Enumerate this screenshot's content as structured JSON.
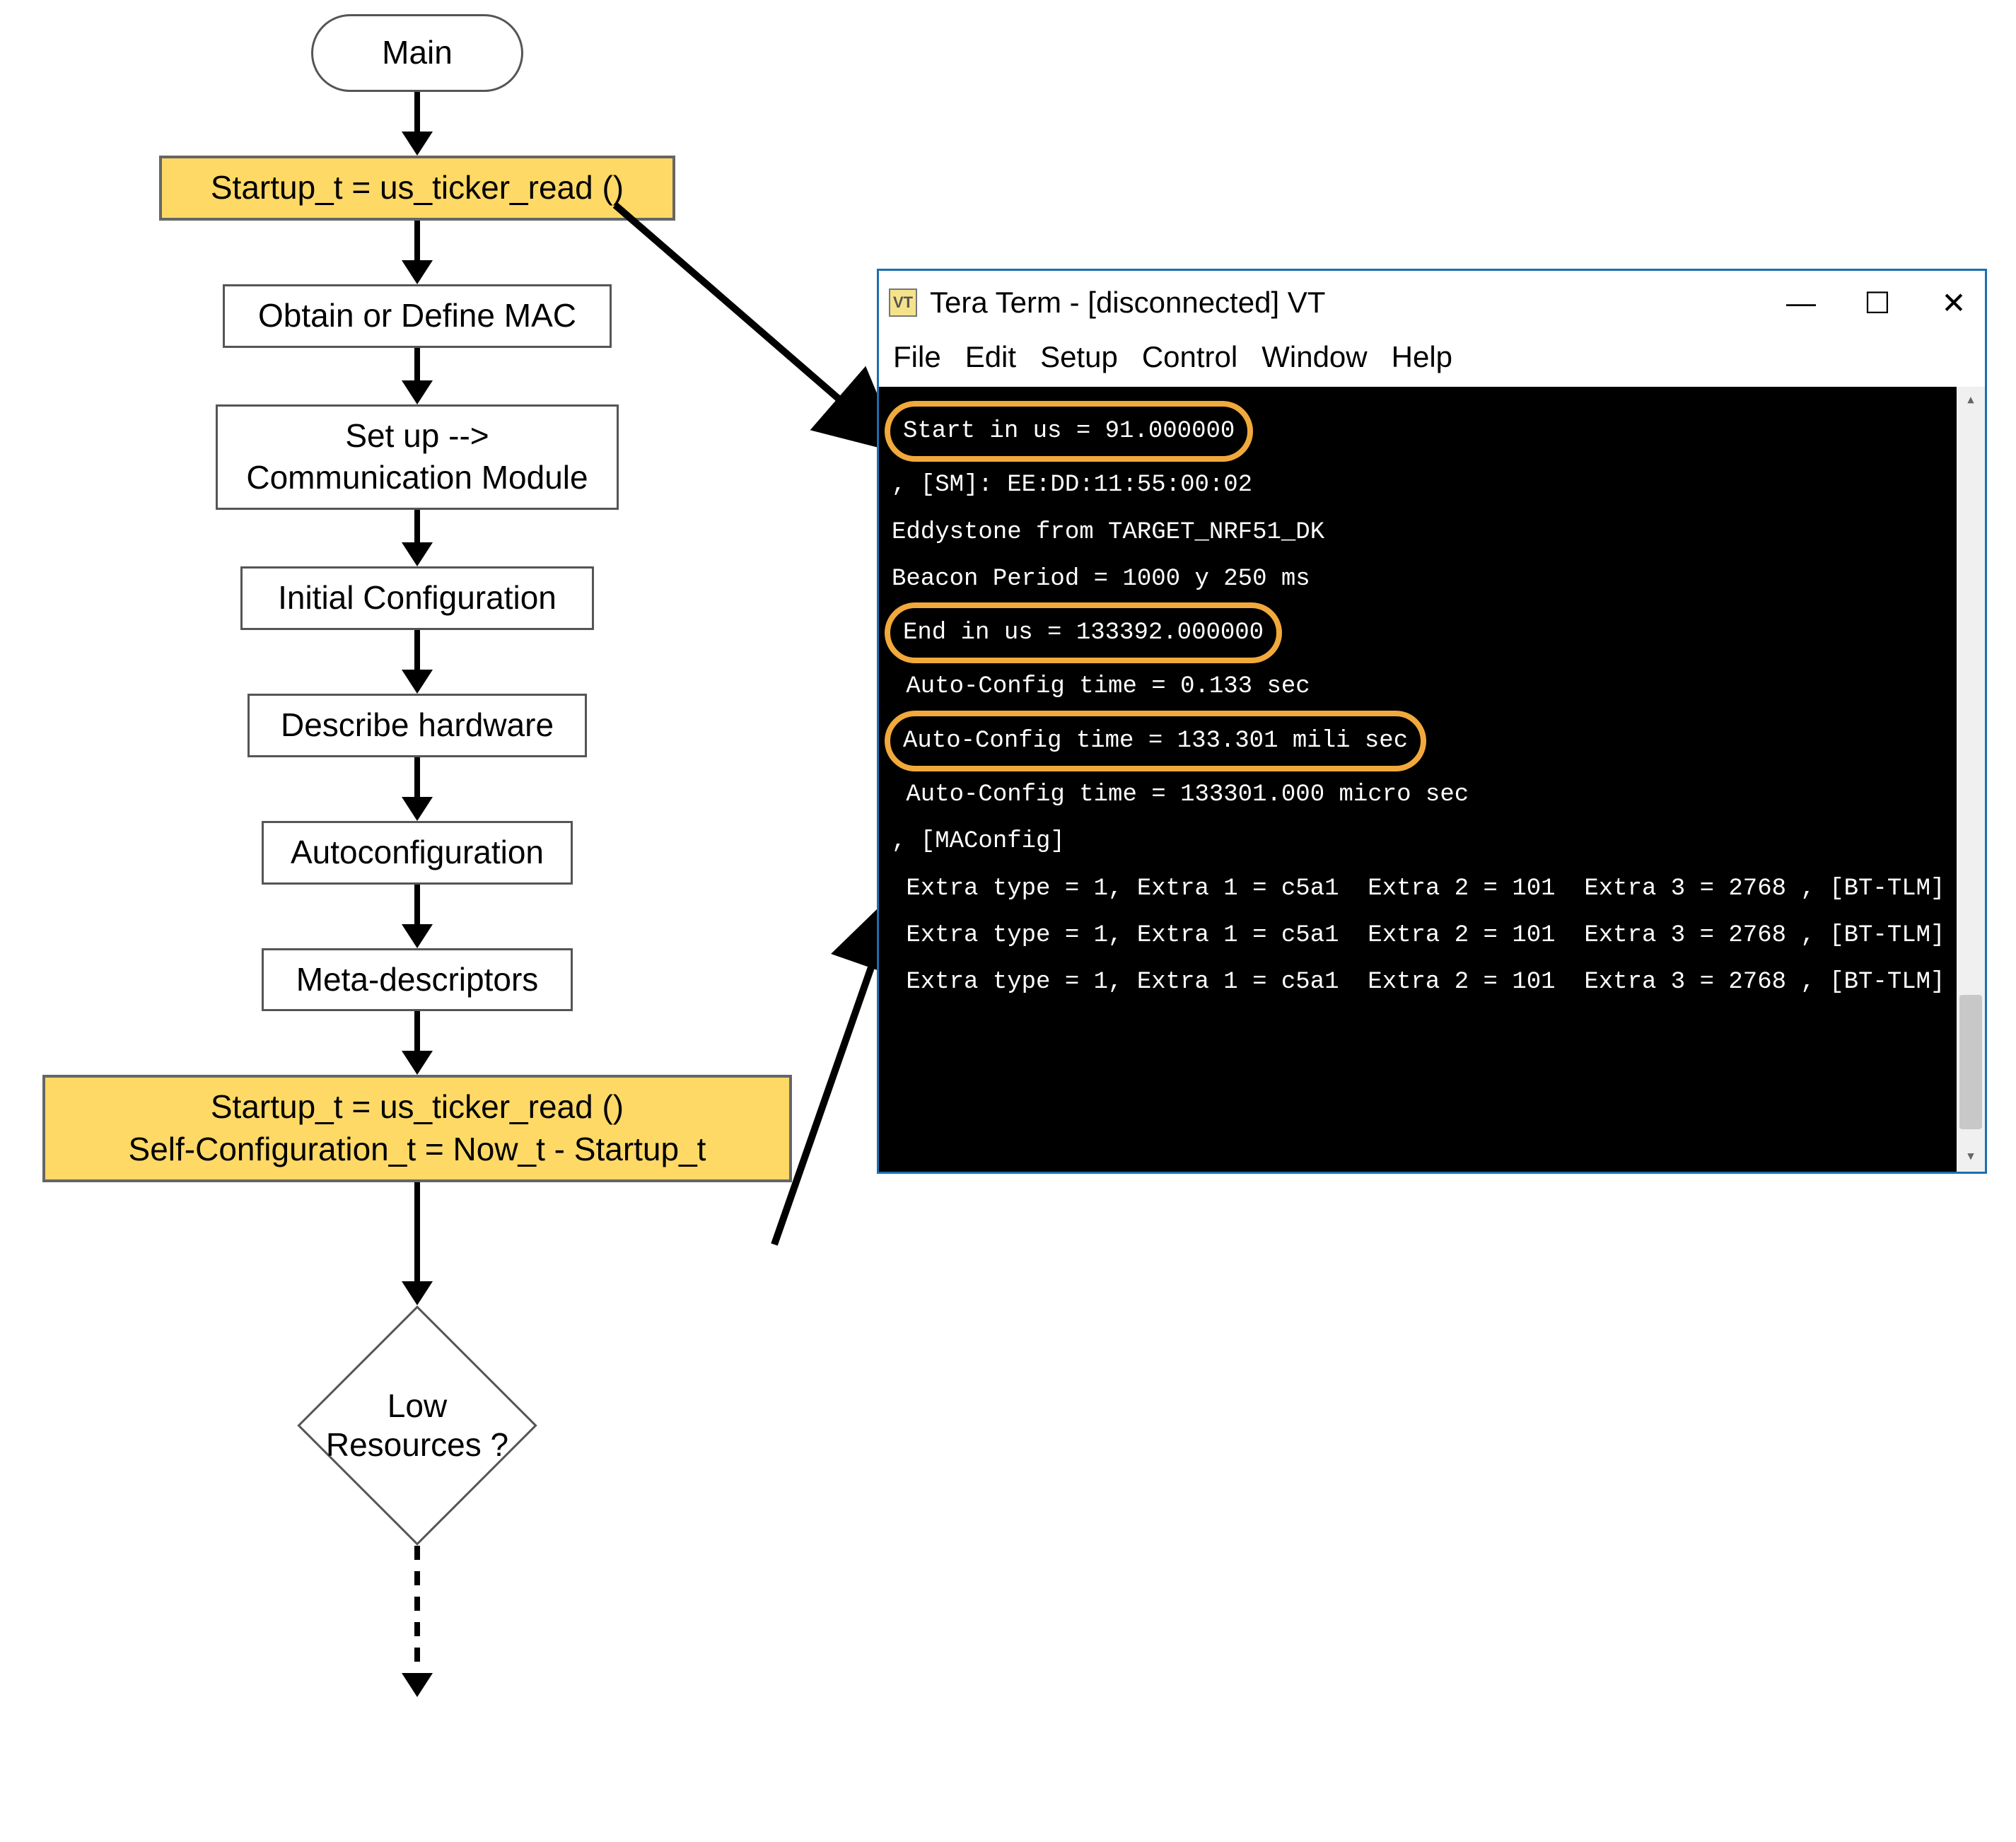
{
  "flowchart": {
    "main": "Main",
    "step1": "Startup_t = us_ticker_read ()",
    "step2": "Obtain or Define MAC",
    "step3_l1": "Set up -->",
    "step3_l2": "Communication Module",
    "step4": "Initial Configuration",
    "step5": "Describe hardware",
    "step6": "Autoconfiguration",
    "step7": "Meta-descriptors",
    "step8_l1": "Startup_t = us_ticker_read ()",
    "step8_l2": "Self-Configuration_t = Now_t - Startup_t",
    "decision_l1": "Low",
    "decision_l2": "Resources ?"
  },
  "terminal": {
    "title": "Tera Term - [disconnected] VT",
    "menus": {
      "file": "File",
      "edit": "Edit",
      "setup": "Setup",
      "control": "Control",
      "window": "Window",
      "help": "Help"
    },
    "lines": {
      "l1": "Start in us = 91.000000",
      "l2": ", [SM]: EE:DD:11:55:00:02",
      "l3": "Eddystone from TARGET_NRF51_DK",
      "l4": "Beacon Period = 1000 y 250 ms",
      "l5": "End in us = 133392.000000",
      "l6": " Auto-Config time = 0.133 sec",
      "l7": "Auto-Config time = 133.301 mili sec",
      "l8": " Auto-Config time = 133301.000 micro sec",
      "l9": ", [MAConfig]",
      "l10": " Extra type = 1, Extra 1 = c5a1  Extra 2 = 101  Extra 3 = 2768 , [BT-TLM]",
      "l11": " Extra type = 1, Extra 1 = c5a1  Extra 2 = 101  Extra 3 = 2768 , [BT-TLM]",
      "l12": " Extra type = 1, Extra 1 = c5a1  Extra 2 = 101  Extra 3 = 2768 , [BT-TLM]"
    },
    "icon_text": "VT"
  },
  "highlighted_terminal_values": {
    "start_us": 91.0,
    "end_us": 133392.0,
    "auto_config_ms": 133.301
  }
}
